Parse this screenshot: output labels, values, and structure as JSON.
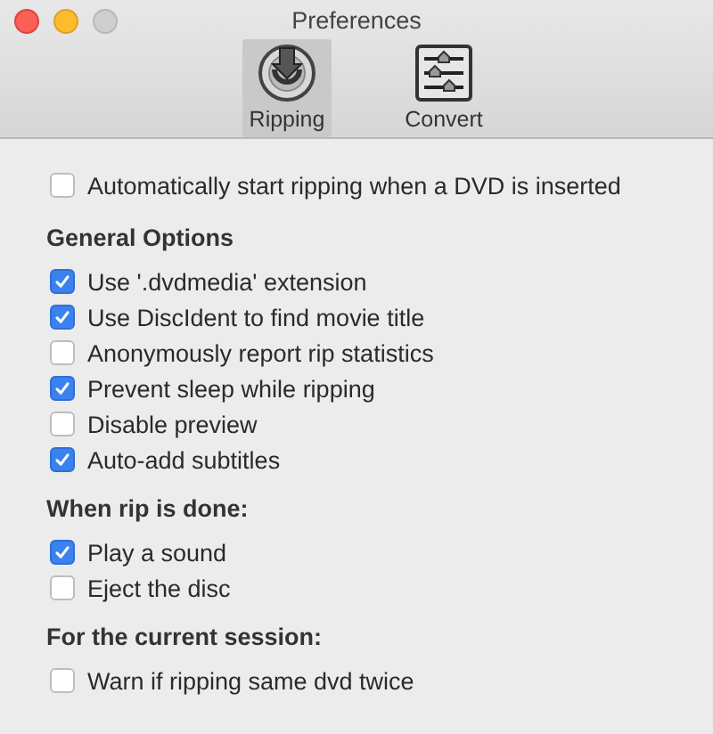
{
  "window": {
    "title": "Preferences"
  },
  "tabs": [
    {
      "label": "Ripping",
      "selected": true,
      "kind": "disc"
    },
    {
      "label": "Convert",
      "selected": false,
      "kind": "sliders"
    }
  ],
  "auto_start": {
    "label": "Automatically start ripping when a DVD is inserted",
    "checked": false
  },
  "sections": [
    {
      "title": "General Options",
      "options": [
        {
          "label": "Use '.dvdmedia' extension",
          "checked": true
        },
        {
          "label": "Use DiscIdent to find movie title",
          "checked": true
        },
        {
          "label": "Anonymously report rip statistics",
          "checked": false
        },
        {
          "label": "Prevent sleep while ripping",
          "checked": true
        },
        {
          "label": "Disable preview",
          "checked": false
        },
        {
          "label": "Auto-add subtitles",
          "checked": true
        }
      ]
    },
    {
      "title": "When rip is done:",
      "options": [
        {
          "label": "Play a sound",
          "checked": true
        },
        {
          "label": "Eject the disc",
          "checked": false
        }
      ]
    },
    {
      "title": "For the current session:",
      "options": [
        {
          "label": "Warn if ripping same dvd twice",
          "checked": false
        }
      ]
    }
  ]
}
